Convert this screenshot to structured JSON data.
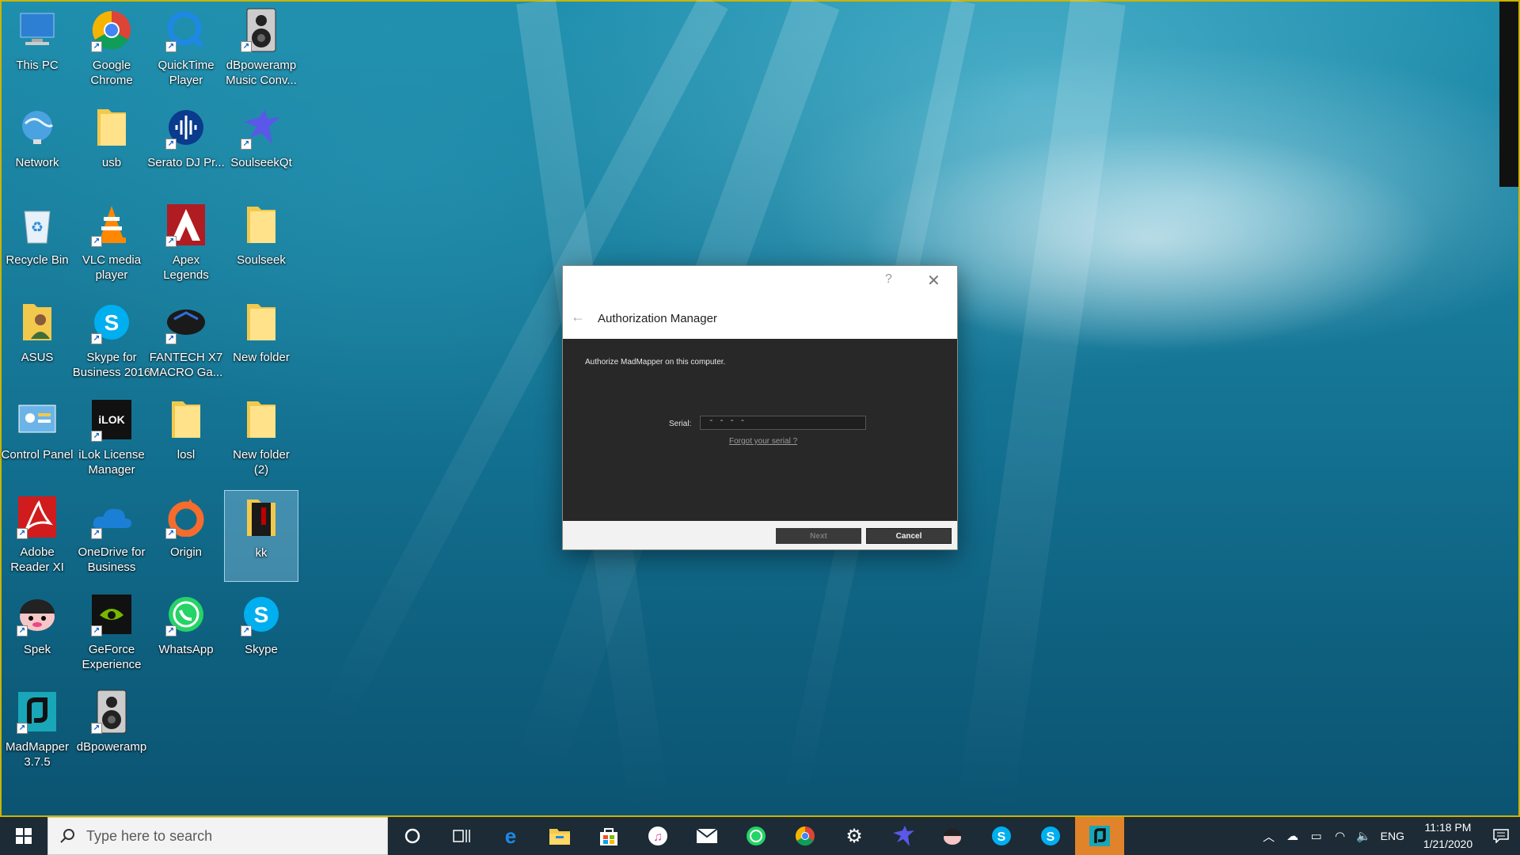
{
  "desktop": {
    "icons": [
      {
        "label": "This PC",
        "icon": "computer-icon"
      },
      {
        "label": "Google\nChrome",
        "icon": "chrome-icon"
      },
      {
        "label": "QuickTime\nPlayer",
        "icon": "quicktime-icon"
      },
      {
        "label": "dBpoweramp\nMusic Conv...",
        "icon": "speaker-icon"
      },
      {
        "label": "Network",
        "icon": "network-globe-icon"
      },
      {
        "label": "usb",
        "icon": "folder-icon"
      },
      {
        "label": "Serato DJ Pr...",
        "icon": "serato-icon"
      },
      {
        "label": "SoulseekQt",
        "icon": "bird-icon"
      },
      {
        "label": "Recycle Bin",
        "icon": "recycle-bin-icon"
      },
      {
        "label": "VLC media\nplayer",
        "icon": "vlc-cone-icon"
      },
      {
        "label": "Apex\nLegends",
        "icon": "apex-icon"
      },
      {
        "label": "Soulseek",
        "icon": "folder-icon"
      },
      {
        "label": "ASUS",
        "icon": "user-folder-icon"
      },
      {
        "label": "Skype for\nBusiness 2016",
        "icon": "skype-icon"
      },
      {
        "label": "FANTECH X7\nMACRO Ga...",
        "icon": "gaming-mouse-icon"
      },
      {
        "label": "New folder",
        "icon": "folder-icon"
      },
      {
        "label": "Control Panel",
        "icon": "control-panel-icon"
      },
      {
        "label": "iLok License\nManager",
        "icon": "ilok-icon"
      },
      {
        "label": "losl",
        "icon": "folder-icon"
      },
      {
        "label": "New folder\n(2)",
        "icon": "folder-icon"
      },
      {
        "label": "Adobe\nReader XI",
        "icon": "adobe-reader-icon"
      },
      {
        "label": "OneDrive for\nBusiness",
        "icon": "onedrive-icon"
      },
      {
        "label": "Origin",
        "icon": "origin-icon"
      },
      {
        "label": "kk",
        "icon": "folder-dark-icon"
      },
      {
        "label": "Spek",
        "icon": "spek-icon"
      },
      {
        "label": "GeForce\nExperience",
        "icon": "geforce-icon"
      },
      {
        "label": "WhatsApp",
        "icon": "whatsapp-icon"
      },
      {
        "label": "Skype",
        "icon": "skype-icon"
      },
      {
        "label": "MadMapper\n3.7.5",
        "icon": "madmapper-icon"
      },
      {
        "label": "dBpoweramp",
        "icon": "speaker-icon"
      }
    ]
  },
  "dialog": {
    "help": "?",
    "close": "✕",
    "back": "←",
    "title": "Authorization Manager",
    "message": "Authorize MadMapper on this computer.",
    "serial_label": "Serial:",
    "serial_value": "-  -  -  -",
    "forgot_link": "Forgot your serial ?",
    "next_label": "Next",
    "cancel_label": "Cancel"
  },
  "taskbar": {
    "search_placeholder": "Type here to search",
    "apps": [
      "cortana-icon",
      "task-view-icon",
      "edge-icon",
      "file-explorer-icon",
      "store-icon",
      "itunes-icon",
      "mail-icon",
      "whatsapp-icon",
      "chrome-icon",
      "settings-gear-icon",
      "soulseek-bird-icon",
      "spek-icon",
      "skype-icon",
      "skype-business-icon",
      "madmapper-icon"
    ],
    "tray": {
      "language": "ENG",
      "time": "11:18 PM",
      "date": "1/21/2020"
    }
  }
}
